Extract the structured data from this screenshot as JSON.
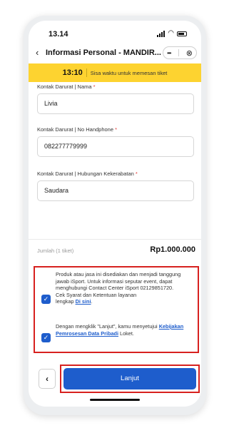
{
  "status_bar": {
    "time": "13.14"
  },
  "header": {
    "title": "Informasi Personal - MANDIR...",
    "more_icon": "more-horizontal-icon",
    "close_icon": "close-circle-icon",
    "more_glyph": "•••",
    "close_glyph": "⊗"
  },
  "timer": {
    "value": "13:10",
    "text": "Sisa waktu untuk memesan tiket",
    "background": "#fdd330"
  },
  "form": {
    "fields": [
      {
        "label": "Kontak Darurat | Nama",
        "value": "Livia"
      },
      {
        "label": "Kontak Darurat | No Handphone",
        "value": "082277779999"
      },
      {
        "label": "Kontak Darurat | Hubungan Kekerabatan",
        "value": "Saudara"
      }
    ],
    "required_mark": "*"
  },
  "total": {
    "label": "Jumlah (1 tiket)",
    "value": "Rp1.000.000"
  },
  "consent": {
    "terms_text": "Produk atau jasa ini disediakan dan menjadi tanggung jawab iSport. Untuk informasi seputar event, dapat menghubungi Contact Center iSport 02129851720.",
    "terms_text_2": "Cek Syarat dan Ketentuan layanan lengkap Di sini.",
    "terms_line_a": "Cek Syarat dan Ketentuan layanan",
    "terms_line_b": "lengkap",
    "terms_link": "Di sini",
    "privacy_prefix": "Dengan mengklik \"Lanjut\", kamu menyetujui",
    "privacy_link": "Kebijakan Pemrosesan Data Pribadi",
    "privacy_suffix": "Loket.",
    "checkbox_glyph": "✓"
  },
  "footer": {
    "back_glyph": "‹",
    "next_label": "Lanjut"
  },
  "colors": {
    "accent": "#1e5dcc",
    "highlight": "#d7211f"
  }
}
